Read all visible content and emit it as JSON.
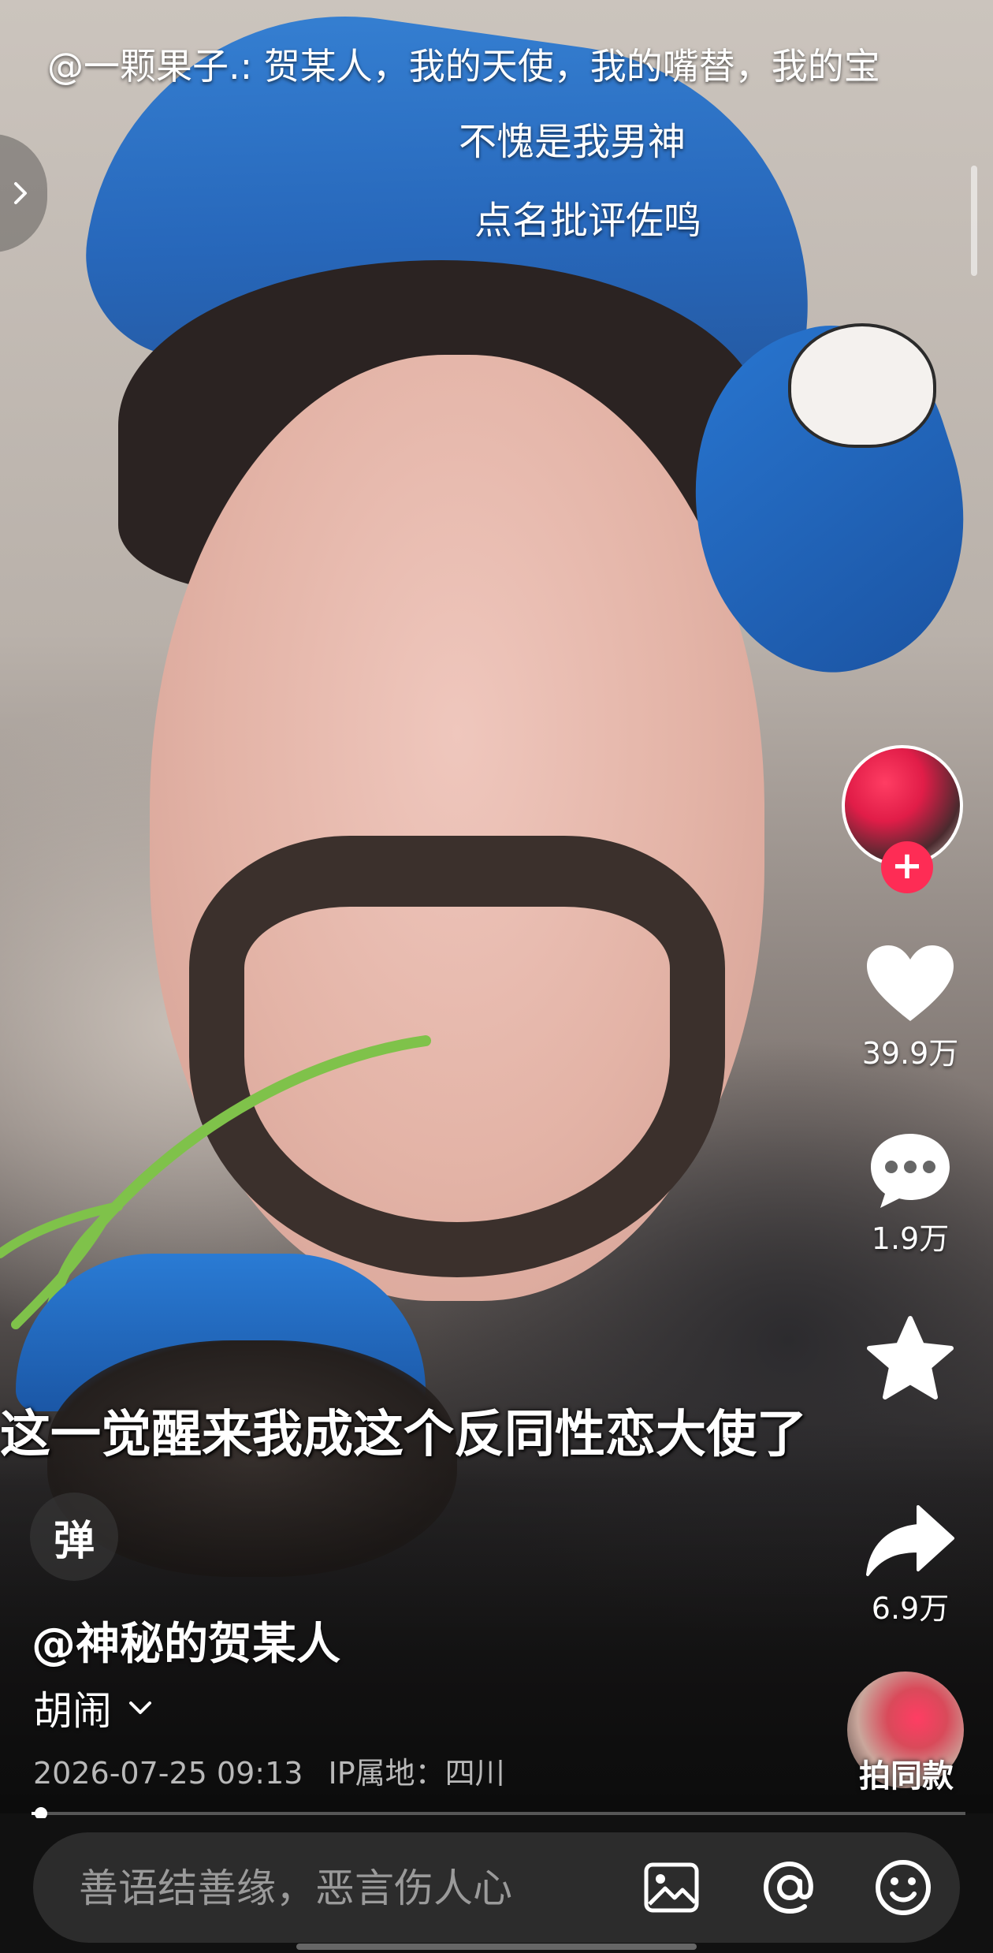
{
  "danmaku": [
    "@一颗果子.: 贺某人，我的天使，我的嘴替，我的宝",
    "不愧是我男神",
    "点名批评佐鸣"
  ],
  "subtitle": "这一觉醒来我成这个反同性恋大使了",
  "creator": {
    "follow_icon": "plus-icon"
  },
  "actions": {
    "like_count": "39.9万",
    "comment_count": "1.9万",
    "share_count": "6.9万"
  },
  "remix_label": "拍同款",
  "danmu_toggle_label": "弹",
  "video": {
    "author": "@神秘的贺某人",
    "description": "胡闹",
    "timestamp": "2026-07-25 09:13",
    "ip_location": "IP属地：四川",
    "progress": 0.01
  },
  "comment": {
    "placeholder": "善语结善缘，恶言伤人心"
  },
  "icons": {
    "like": "heart-icon",
    "comment": "comment-bubble-icon",
    "favorite": "star-icon",
    "share": "share-arrow-icon",
    "image": "image-icon",
    "mention": "at-icon",
    "emoji": "emoji-icon",
    "expand": "chevron-down-icon",
    "side_panel": "chevron-right-icon"
  },
  "colors": {
    "follow_accent": "#fe2c55",
    "cap_blue": "#1f63bb",
    "bottom_bar": "#111111"
  }
}
